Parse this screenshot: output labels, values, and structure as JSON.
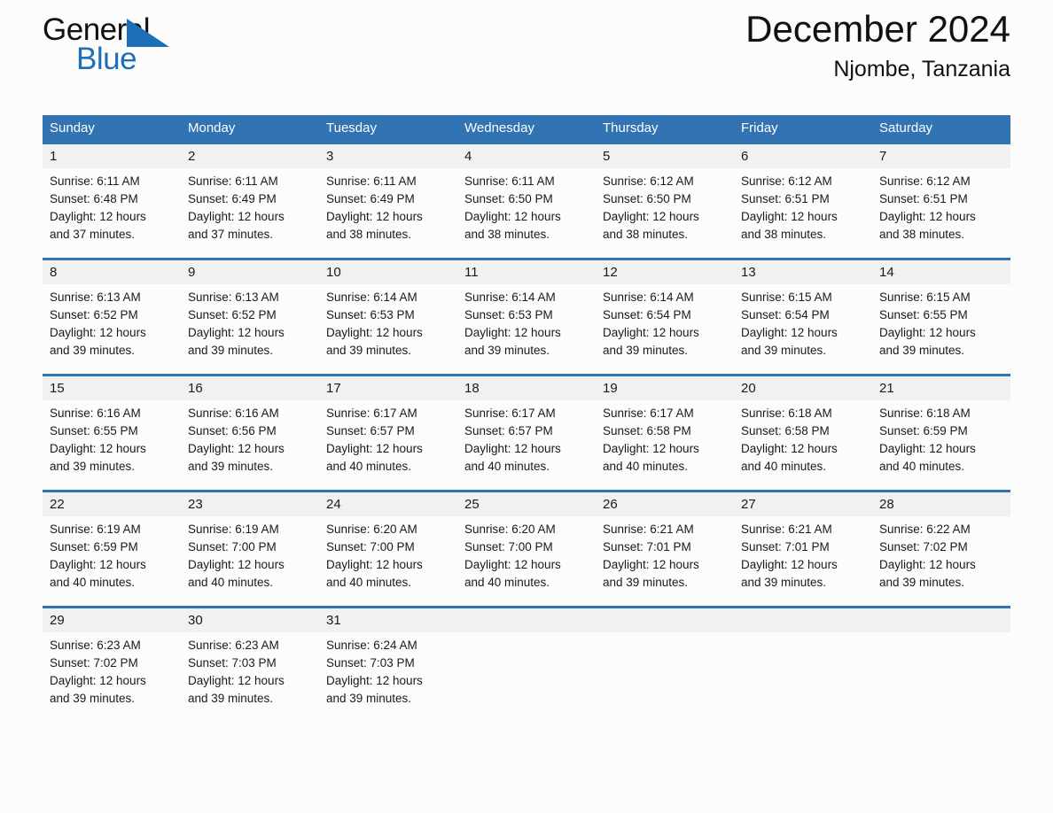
{
  "brand": {
    "name_part1": "General",
    "name_part2": "Blue",
    "triangle_icon": "brand-triangle-icon",
    "accent_color": "#1d70b7"
  },
  "header": {
    "title": "December 2024",
    "subtitle": "Njombe, Tanzania"
  },
  "colors": {
    "header_blue": "#3273b3",
    "row_divider_blue": "#3273b3",
    "date_band_gray": "#f1f1f1",
    "page_background": "#fcfcfc",
    "text": "#1a1a1a"
  },
  "weekdays": [
    "Sunday",
    "Monday",
    "Tuesday",
    "Wednesday",
    "Thursday",
    "Friday",
    "Saturday"
  ],
  "weeks": [
    [
      {
        "date": "1",
        "sunrise": "Sunrise: 6:11 AM",
        "sunset": "Sunset: 6:48 PM",
        "daylight_line1": "Daylight: 12 hours",
        "daylight_line2": "and 37 minutes."
      },
      {
        "date": "2",
        "sunrise": "Sunrise: 6:11 AM",
        "sunset": "Sunset: 6:49 PM",
        "daylight_line1": "Daylight: 12 hours",
        "daylight_line2": "and 37 minutes."
      },
      {
        "date": "3",
        "sunrise": "Sunrise: 6:11 AM",
        "sunset": "Sunset: 6:49 PM",
        "daylight_line1": "Daylight: 12 hours",
        "daylight_line2": "and 38 minutes."
      },
      {
        "date": "4",
        "sunrise": "Sunrise: 6:11 AM",
        "sunset": "Sunset: 6:50 PM",
        "daylight_line1": "Daylight: 12 hours",
        "daylight_line2": "and 38 minutes."
      },
      {
        "date": "5",
        "sunrise": "Sunrise: 6:12 AM",
        "sunset": "Sunset: 6:50 PM",
        "daylight_line1": "Daylight: 12 hours",
        "daylight_line2": "and 38 minutes."
      },
      {
        "date": "6",
        "sunrise": "Sunrise: 6:12 AM",
        "sunset": "Sunset: 6:51 PM",
        "daylight_line1": "Daylight: 12 hours",
        "daylight_line2": "and 38 minutes."
      },
      {
        "date": "7",
        "sunrise": "Sunrise: 6:12 AM",
        "sunset": "Sunset: 6:51 PM",
        "daylight_line1": "Daylight: 12 hours",
        "daylight_line2": "and 38 minutes."
      }
    ],
    [
      {
        "date": "8",
        "sunrise": "Sunrise: 6:13 AM",
        "sunset": "Sunset: 6:52 PM",
        "daylight_line1": "Daylight: 12 hours",
        "daylight_line2": "and 39 minutes."
      },
      {
        "date": "9",
        "sunrise": "Sunrise: 6:13 AM",
        "sunset": "Sunset: 6:52 PM",
        "daylight_line1": "Daylight: 12 hours",
        "daylight_line2": "and 39 minutes."
      },
      {
        "date": "10",
        "sunrise": "Sunrise: 6:14 AM",
        "sunset": "Sunset: 6:53 PM",
        "daylight_line1": "Daylight: 12 hours",
        "daylight_line2": "and 39 minutes."
      },
      {
        "date": "11",
        "sunrise": "Sunrise: 6:14 AM",
        "sunset": "Sunset: 6:53 PM",
        "daylight_line1": "Daylight: 12 hours",
        "daylight_line2": "and 39 minutes."
      },
      {
        "date": "12",
        "sunrise": "Sunrise: 6:14 AM",
        "sunset": "Sunset: 6:54 PM",
        "daylight_line1": "Daylight: 12 hours",
        "daylight_line2": "and 39 minutes."
      },
      {
        "date": "13",
        "sunrise": "Sunrise: 6:15 AM",
        "sunset": "Sunset: 6:54 PM",
        "daylight_line1": "Daylight: 12 hours",
        "daylight_line2": "and 39 minutes."
      },
      {
        "date": "14",
        "sunrise": "Sunrise: 6:15 AM",
        "sunset": "Sunset: 6:55 PM",
        "daylight_line1": "Daylight: 12 hours",
        "daylight_line2": "and 39 minutes."
      }
    ],
    [
      {
        "date": "15",
        "sunrise": "Sunrise: 6:16 AM",
        "sunset": "Sunset: 6:55 PM",
        "daylight_line1": "Daylight: 12 hours",
        "daylight_line2": "and 39 minutes."
      },
      {
        "date": "16",
        "sunrise": "Sunrise: 6:16 AM",
        "sunset": "Sunset: 6:56 PM",
        "daylight_line1": "Daylight: 12 hours",
        "daylight_line2": "and 39 minutes."
      },
      {
        "date": "17",
        "sunrise": "Sunrise: 6:17 AM",
        "sunset": "Sunset: 6:57 PM",
        "daylight_line1": "Daylight: 12 hours",
        "daylight_line2": "and 40 minutes."
      },
      {
        "date": "18",
        "sunrise": "Sunrise: 6:17 AM",
        "sunset": "Sunset: 6:57 PM",
        "daylight_line1": "Daylight: 12 hours",
        "daylight_line2": "and 40 minutes."
      },
      {
        "date": "19",
        "sunrise": "Sunrise: 6:17 AM",
        "sunset": "Sunset: 6:58 PM",
        "daylight_line1": "Daylight: 12 hours",
        "daylight_line2": "and 40 minutes."
      },
      {
        "date": "20",
        "sunrise": "Sunrise: 6:18 AM",
        "sunset": "Sunset: 6:58 PM",
        "daylight_line1": "Daylight: 12 hours",
        "daylight_line2": "and 40 minutes."
      },
      {
        "date": "21",
        "sunrise": "Sunrise: 6:18 AM",
        "sunset": "Sunset: 6:59 PM",
        "daylight_line1": "Daylight: 12 hours",
        "daylight_line2": "and 40 minutes."
      }
    ],
    [
      {
        "date": "22",
        "sunrise": "Sunrise: 6:19 AM",
        "sunset": "Sunset: 6:59 PM",
        "daylight_line1": "Daylight: 12 hours",
        "daylight_line2": "and 40 minutes."
      },
      {
        "date": "23",
        "sunrise": "Sunrise: 6:19 AM",
        "sunset": "Sunset: 7:00 PM",
        "daylight_line1": "Daylight: 12 hours",
        "daylight_line2": "and 40 minutes."
      },
      {
        "date": "24",
        "sunrise": "Sunrise: 6:20 AM",
        "sunset": "Sunset: 7:00 PM",
        "daylight_line1": "Daylight: 12 hours",
        "daylight_line2": "and 40 minutes."
      },
      {
        "date": "25",
        "sunrise": "Sunrise: 6:20 AM",
        "sunset": "Sunset: 7:00 PM",
        "daylight_line1": "Daylight: 12 hours",
        "daylight_line2": "and 40 minutes."
      },
      {
        "date": "26",
        "sunrise": "Sunrise: 6:21 AM",
        "sunset": "Sunset: 7:01 PM",
        "daylight_line1": "Daylight: 12 hours",
        "daylight_line2": "and 39 minutes."
      },
      {
        "date": "27",
        "sunrise": "Sunrise: 6:21 AM",
        "sunset": "Sunset: 7:01 PM",
        "daylight_line1": "Daylight: 12 hours",
        "daylight_line2": "and 39 minutes."
      },
      {
        "date": "28",
        "sunrise": "Sunrise: 6:22 AM",
        "sunset": "Sunset: 7:02 PM",
        "daylight_line1": "Daylight: 12 hours",
        "daylight_line2": "and 39 minutes."
      }
    ],
    [
      {
        "date": "29",
        "sunrise": "Sunrise: 6:23 AM",
        "sunset": "Sunset: 7:02 PM",
        "daylight_line1": "Daylight: 12 hours",
        "daylight_line2": "and 39 minutes."
      },
      {
        "date": "30",
        "sunrise": "Sunrise: 6:23 AM",
        "sunset": "Sunset: 7:03 PM",
        "daylight_line1": "Daylight: 12 hours",
        "daylight_line2": "and 39 minutes."
      },
      {
        "date": "31",
        "sunrise": "Sunrise: 6:24 AM",
        "sunset": "Sunset: 7:03 PM",
        "daylight_line1": "Daylight: 12 hours",
        "daylight_line2": "and 39 minutes."
      },
      {
        "date": "",
        "sunrise": "",
        "sunset": "",
        "daylight_line1": "",
        "daylight_line2": ""
      },
      {
        "date": "",
        "sunrise": "",
        "sunset": "",
        "daylight_line1": "",
        "daylight_line2": ""
      },
      {
        "date": "",
        "sunrise": "",
        "sunset": "",
        "daylight_line1": "",
        "daylight_line2": ""
      },
      {
        "date": "",
        "sunrise": "",
        "sunset": "",
        "daylight_line1": "",
        "daylight_line2": ""
      }
    ]
  ]
}
